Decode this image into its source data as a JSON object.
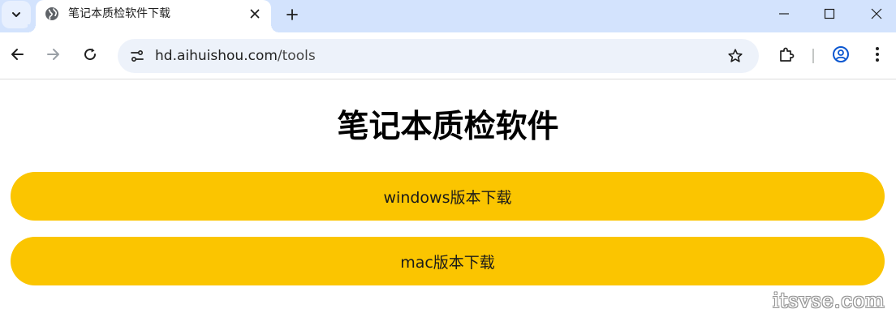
{
  "tab": {
    "title": "笔记本质检软件下载"
  },
  "address_bar": {
    "host": "hd.aihuishou.com",
    "path": "/tools"
  },
  "page": {
    "heading": "笔记本质检软件",
    "buttons": [
      {
        "label": "windows版本下载"
      },
      {
        "label": "mac版本下载"
      }
    ]
  },
  "watermark": "itsvse.com",
  "colors": {
    "tabstrip": "#d3e3fd",
    "omnibox": "#edf2fa",
    "button": "#fbc500",
    "profile_accent": "#0b57d0"
  },
  "icons": [
    "tab-search-icon",
    "globe-icon",
    "close-icon",
    "plus-icon",
    "minimize-icon",
    "maximize-icon",
    "window-close-icon",
    "back-arrow-icon",
    "forward-arrow-icon",
    "reload-icon",
    "site-settings-icon",
    "star-icon",
    "extensions-icon",
    "profile-icon",
    "more-menu-icon"
  ]
}
